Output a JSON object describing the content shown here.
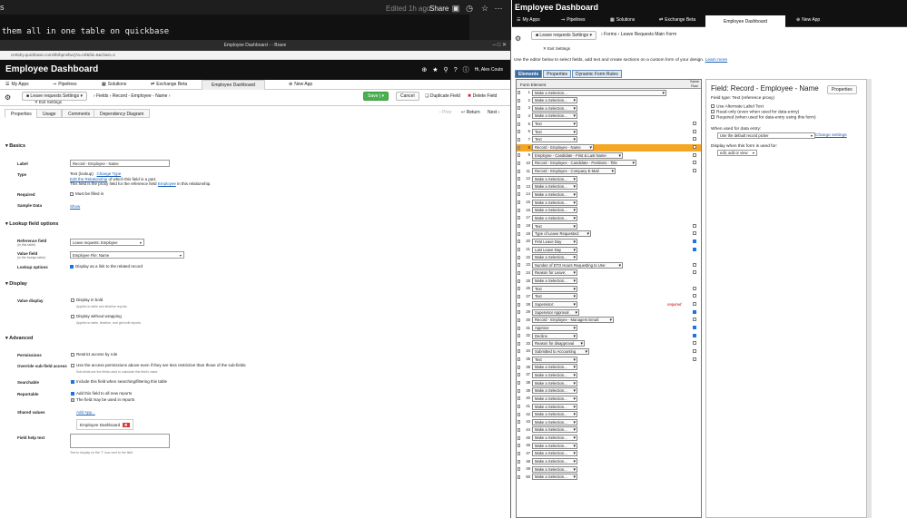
{
  "top_strip": {
    "s_text": "s",
    "code_text": "them all in one table on quickbase",
    "edited": "Edited 1h ago",
    "share": "Share"
  },
  "left_window": {
    "title": "Employee Dashboard - - Brave",
    "url": "certidry.quickbase.com/db/bpnsfwvj?a=mf&fid=6&chain=1",
    "app_title": "Employee Dashboard",
    "user": "Hi, Alex Couts",
    "nav": {
      "my_apps": "My Apps",
      "pipelines": "Pipelines",
      "solutions": "Solutions",
      "exchange": "Exchange Beta",
      "employee_dashboard": "Employee Dashboard",
      "new_app": "New App"
    },
    "table_selector": "Leave requests Settings",
    "breadcrumb": [
      "Fields",
      "Record - Employee - Name"
    ],
    "exit_settings": "Exit Settings",
    "buttons": {
      "save": "Save",
      "cancel": "Cancel",
      "duplicate": "Duplicate Field",
      "delete": "Delete Field"
    },
    "pager": {
      "prev": "Prev",
      "return": "Return",
      "next": "Next"
    },
    "tabs": [
      "Properties",
      "Usage",
      "Comments",
      "Dependency Diagram"
    ],
    "basics": {
      "heading": "Basics",
      "label_lbl": "Label",
      "label_val": "Record - Employee - Name",
      "type_lbl": "Type",
      "type_val": "Text (lookup)",
      "change_type": "Change Type",
      "type_line2_link": "Edit the Relationship",
      "type_line2_rest": "of which this field is a part.",
      "type_line3_a": "This field is the proxy field for the reference field",
      "type_line3_link": "Employee",
      "type_line3_b": "in this relationship.",
      "required_lbl": "Required",
      "required_val": "Must be filled in",
      "sample_lbl": "Sample Data",
      "sample_val": "Show"
    },
    "lookup": {
      "heading": "Lookup field options",
      "ref_lbl": "Reference field",
      "ref_sub": "(in this table)",
      "ref_val": "Leave requests: Employee",
      "value_lbl": "Value field",
      "value_sub": "(in the foreign table)",
      "value_val": "Employee File: Name",
      "opts_lbl": "Lookup options",
      "opts_val": "Display as a link to the related record"
    },
    "display": {
      "heading": "Display",
      "vd_lbl": "Value display",
      "bold": "Display in bold",
      "bold_hint": "Applies to table and timeline reports",
      "wrap": "Display without wrapping",
      "wrap_hint": "Applies to table, timeline, and grid edit reports"
    },
    "advanced": {
      "heading": "Advanced",
      "perm_lbl": "Permissions",
      "perm_val": "Restrict access by role",
      "override_lbl": "Override sub-field access",
      "override_val": "Use the access permissions above even if they are less restrictive than those of the sub-fields",
      "override_hint": "Sub-fields are the fields used to calculate this field's value",
      "search_lbl": "Searchable",
      "search_val": "Include this field when searching/filtering this table",
      "report_lbl": "Reportable",
      "report_val1": "Add this field to all new reports",
      "report_val2": "The field may be used in reports",
      "shared_lbl": "Shared values",
      "add_app": "Add App...",
      "app_chip": "Employee Dashboard",
      "help_lbl": "Field help text",
      "help_hint": "Text to display on the \"i\" icon next to the field"
    }
  },
  "right_window": {
    "app_title": "Employee Dashboard",
    "nav": {
      "my_apps": "My Apps",
      "pipelines": "Pipelines",
      "solutions": "Solutions",
      "exchange": "Exchange Beta",
      "employee_dashboard": "Employee Dashboard",
      "new_app": "New App"
    },
    "table_selector": "Leave requests Settings",
    "breadcrumb": [
      "Forms",
      "Leave Requests Main Form"
    ],
    "exit_settings": "Exit Settings",
    "instructions": "Use the editor below to select fields, add text and create sections on a custom form of your design.",
    "learn_more": "Learn more",
    "editor_tabs": [
      "Elements",
      "Properties",
      "Dynamic Form Rules"
    ],
    "table_head": {
      "element": "Form Element",
      "same_row": "Same Row"
    },
    "rows": [
      {
        "n": "1",
        "v": "Make a Selection...",
        "w": 148,
        "ck": null
      },
      {
        "n": "2",
        "v": "Make a Selection...",
        "w": 50,
        "ck": null
      },
      {
        "n": "3",
        "v": "Make a Selection...",
        "w": 50,
        "ck": null
      },
      {
        "n": "4",
        "v": "Make a Selection...",
        "w": 50,
        "ck": null
      },
      {
        "n": "5",
        "v": "Text",
        "w": 50,
        "ck": false
      },
      {
        "n": "6",
        "v": "Text",
        "w": 50,
        "ck": false
      },
      {
        "n": "7",
        "v": "Text",
        "w": 50,
        "ck": false
      },
      {
        "n": "8",
        "v": "Record - Employee - Name",
        "w": 68,
        "ck": false,
        "hl": true
      },
      {
        "n": "9",
        "v": "Employee - Candidate - First & Last Name",
        "w": 100,
        "ck": false
      },
      {
        "n": "10",
        "v": "Record - Employee - Candidate - Positions - Title",
        "w": 115,
        "ck": false
      },
      {
        "n": "11",
        "v": "Record - Employee - Company E-Mail",
        "w": 92,
        "ck": false
      },
      {
        "n": "12",
        "v": "Make a Selection...",
        "w": 50,
        "ck": null
      },
      {
        "n": "13",
        "v": "Make a Selection...",
        "w": 50,
        "ck": null
      },
      {
        "n": "14",
        "v": "Make a Selection...",
        "w": 50,
        "ck": null
      },
      {
        "n": "15",
        "v": "Make a Selection...",
        "w": 50,
        "ck": null
      },
      {
        "n": "16",
        "v": "Make a Selection...",
        "w": 50,
        "ck": null
      },
      {
        "n": "17",
        "v": "Make a Selection...",
        "w": 50,
        "ck": null
      },
      {
        "n": "18",
        "v": "Text",
        "w": 50,
        "ck": false
      },
      {
        "n": "19",
        "v": "Type of Leave Requested:",
        "w": 65,
        "ck": false
      },
      {
        "n": "20",
        "v": "First Leave Day",
        "w": 50,
        "ck": true
      },
      {
        "n": "21",
        "v": "Last Leave Day",
        "w": 50,
        "ck": true
      },
      {
        "n": "22",
        "v": "Make a Selection...",
        "w": 50,
        "ck": null
      },
      {
        "n": "23",
        "v": "Number of ETO Hours Requesting to Use:",
        "w": 100,
        "ck": false
      },
      {
        "n": "24",
        "v": "Reason for Leave:",
        "w": 50,
        "ck": false
      },
      {
        "n": "25",
        "v": "Make a Selection...",
        "w": 50,
        "ck": null
      },
      {
        "n": "26",
        "v": "Text",
        "w": 50,
        "ck": false
      },
      {
        "n": "27",
        "v": "Text",
        "w": 50,
        "ck": false
      },
      {
        "n": "28",
        "v": "Supervisor:",
        "w": 50,
        "ck": false,
        "req": "required"
      },
      {
        "n": "29",
        "v": "Supervisor Approval",
        "w": 52,
        "ck": true
      },
      {
        "n": "30",
        "v": "Record - Employee - Managers Email:",
        "w": 90,
        "ck": false
      },
      {
        "n": "31",
        "v": "Approve",
        "w": 50,
        "ck": true
      },
      {
        "n": "32",
        "v": "Decline",
        "w": 50,
        "ck": true
      },
      {
        "n": "33",
        "v": "Reason for disapproval",
        "w": 58,
        "ck": false
      },
      {
        "n": "34",
        "v": "Submitted to Accounting",
        "w": 63,
        "ck": false
      },
      {
        "n": "35",
        "v": "Text",
        "w": 50,
        "ck": false
      },
      {
        "n": "36",
        "v": "Make a Selection...",
        "w": 50,
        "ck": null
      },
      {
        "n": "37",
        "v": "Make a Selection...",
        "w": 50,
        "ck": null
      },
      {
        "n": "38",
        "v": "Make a Selection...",
        "w": 50,
        "ck": null
      },
      {
        "n": "39",
        "v": "Make a Selection...",
        "w": 50,
        "ck": null
      },
      {
        "n": "40",
        "v": "Make a Selection...",
        "w": 50,
        "ck": null
      },
      {
        "n": "41",
        "v": "Make a Selection...",
        "w": 50,
        "ck": null
      },
      {
        "n": "42",
        "v": "Make a Selection...",
        "w": 50,
        "ck": null
      },
      {
        "n": "43",
        "v": "Make a Selection...",
        "w": 50,
        "ck": null
      },
      {
        "n": "44",
        "v": "Make a Selection...",
        "w": 50,
        "ck": null
      },
      {
        "n": "45",
        "v": "Make a Selection...",
        "w": 50,
        "ck": null
      },
      {
        "n": "46",
        "v": "Make a Selection...",
        "w": 50,
        "ck": null
      },
      {
        "n": "47",
        "v": "Make a Selection...",
        "w": 50,
        "ck": null
      },
      {
        "n": "48",
        "v": "Make a Selection...",
        "w": 50,
        "ck": null
      },
      {
        "n": "49",
        "v": "Make a Selection...",
        "w": 50,
        "ck": null
      },
      {
        "n": "50",
        "v": "Make a Selection...",
        "w": 50,
        "ck": null
      }
    ],
    "field_panel": {
      "title": "Field: Record - Employee - Name",
      "properties_btn": "Properties",
      "type": "Field type: Text (reference proxy)",
      "opt1": "Use Alternate Label Text",
      "opt2": "Read-only (even when used for data-entry)",
      "opt3": "Required (when used for data-entry using this form)",
      "when_used": "When used for data entry:",
      "picker": "Use the default record picker",
      "change_settings": "Change settings",
      "display_when": "Display when this form is used for:",
      "display_val": "edit, add or view"
    }
  }
}
